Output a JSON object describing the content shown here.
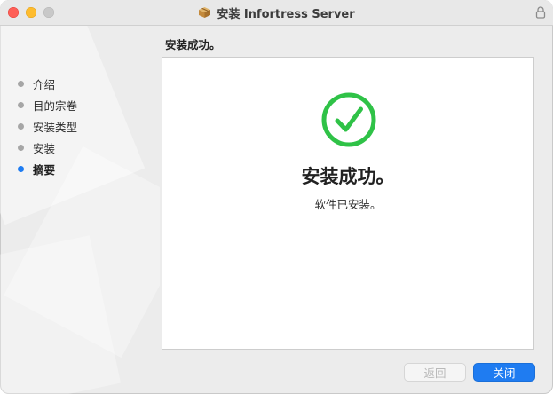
{
  "window": {
    "title": "安装 Infortress Server",
    "app_icon": "package-icon",
    "lock_icon": "lock-icon"
  },
  "sidebar": {
    "steps": [
      {
        "label": "介绍",
        "active": false
      },
      {
        "label": "目的宗卷",
        "active": false
      },
      {
        "label": "安装类型",
        "active": false
      },
      {
        "label": "安装",
        "active": false
      },
      {
        "label": "摘要",
        "active": true
      }
    ]
  },
  "main": {
    "section_title": "安装成功。",
    "status_icon": "checkmark-circle-icon",
    "headline": "安装成功。",
    "subline": "软件已安装。"
  },
  "buttons": {
    "back_label": "返回",
    "close_label": "关闭"
  },
  "colors": {
    "success": "#2fc247",
    "accent": "#1f7cf1"
  }
}
